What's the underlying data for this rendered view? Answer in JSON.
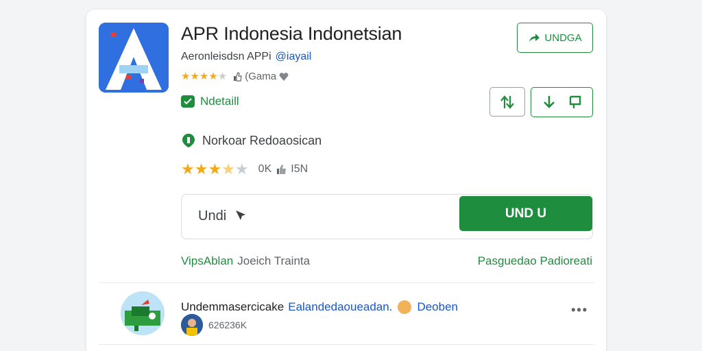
{
  "app": {
    "title": "APR Indonesia Indonetsian",
    "subtitle": "Aeronleisdsn APPi",
    "subtitle_link": "@iayail",
    "rating_stars": 4.5,
    "rating_meta": "(Gama",
    "verified_label": "Ndetaill",
    "network_label": "Norkoar Redoaosican",
    "rating2_stars": 3.5,
    "rating2_count": "0K",
    "rating2_meta": "I5N"
  },
  "actions": {
    "update_label": "UNDGA",
    "share_icon": "share-arrows-icon",
    "download_icon": "download-arrow-icon",
    "bookmark_icon": "bookmark-flag-icon"
  },
  "search": {
    "value": "Undi",
    "button_label": "UND U"
  },
  "links": {
    "left_green": "VipsAblan",
    "left_gray": "Joeich Trainta",
    "right": "Pasguedao Padioreati"
  },
  "comment": {
    "text": "Undemmasercicake",
    "link": "Ealandedaoueadan.",
    "tag": "Deoben",
    "meta": "626236K",
    "more": "•••"
  },
  "colors": {
    "accent": "#1e8e3e",
    "link": "#1a56c4",
    "icon_bg": "#2f6fe0",
    "star": "#f2a91c"
  }
}
